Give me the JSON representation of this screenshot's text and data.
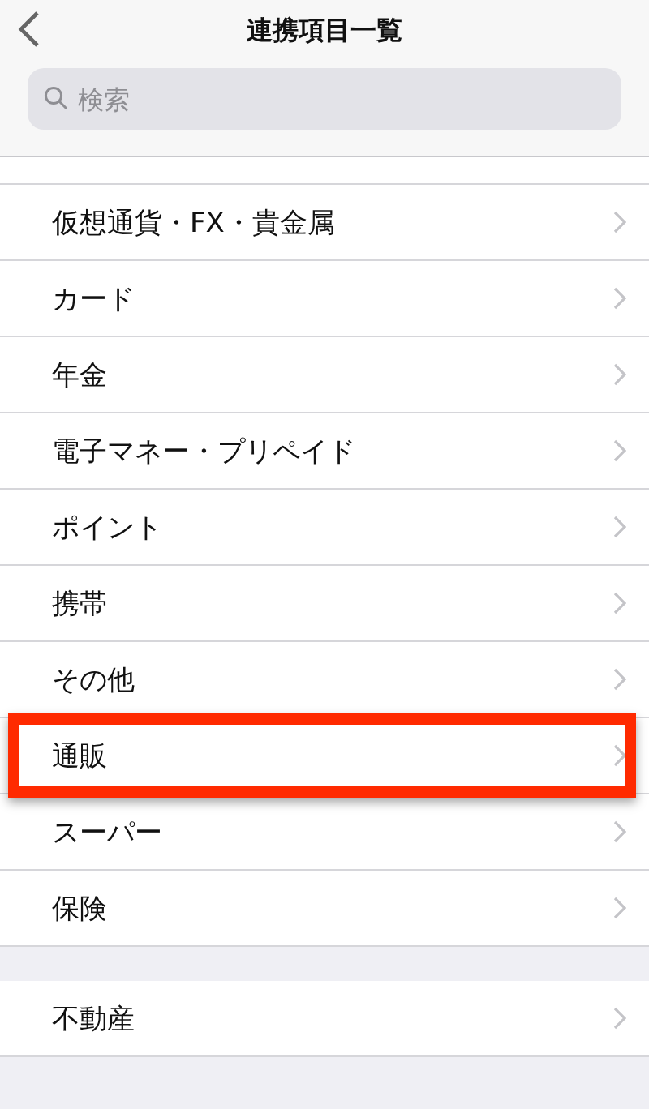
{
  "nav": {
    "title": "連携項目一覧"
  },
  "search": {
    "placeholder": "検索"
  },
  "sections": [
    {
      "items": [
        {
          "label": "仮想通貨・FX・貴金属",
          "highlighted": false
        },
        {
          "label": "カード",
          "highlighted": false
        },
        {
          "label": "年金",
          "highlighted": false
        },
        {
          "label": "電子マネー・プリペイド",
          "highlighted": false
        },
        {
          "label": "ポイント",
          "highlighted": false
        },
        {
          "label": "携帯",
          "highlighted": false
        },
        {
          "label": "その他",
          "highlighted": false
        },
        {
          "label": "通販",
          "highlighted": true
        },
        {
          "label": "スーパー",
          "highlighted": false
        },
        {
          "label": "保険",
          "highlighted": false
        }
      ]
    },
    {
      "items": [
        {
          "label": "不動産",
          "highlighted": false
        }
      ]
    }
  ]
}
